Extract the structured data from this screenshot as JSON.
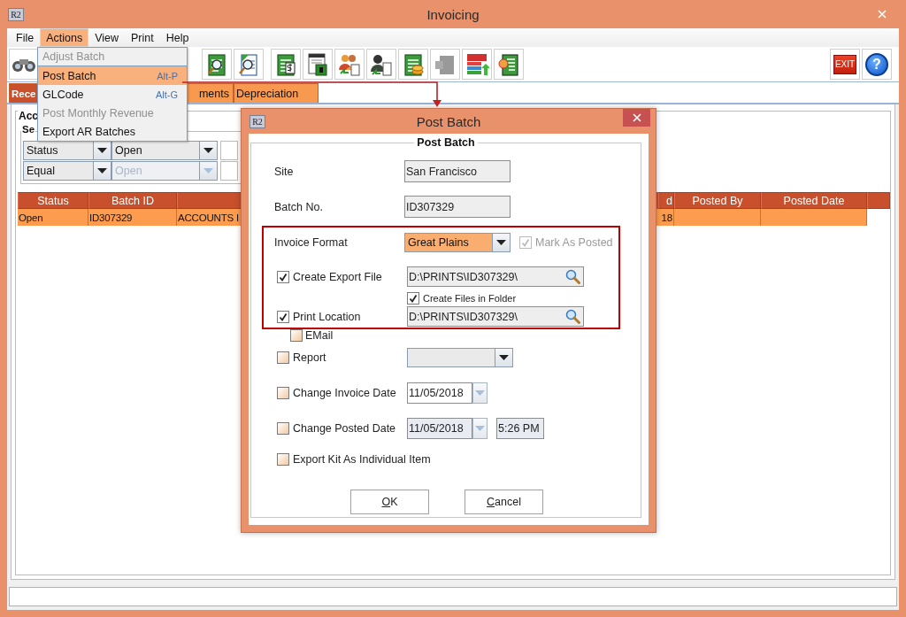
{
  "window": {
    "title": "Invoicing",
    "app_icon": "R2"
  },
  "menu_bar": [
    {
      "label": "File",
      "selected": false
    },
    {
      "label": "Actions",
      "selected": true
    },
    {
      "label": "View",
      "selected": false
    },
    {
      "label": "Print",
      "selected": false
    },
    {
      "label": "Help",
      "selected": false
    }
  ],
  "actions_menu": [
    {
      "label": "Adjust Batch",
      "disabled": true,
      "selected": false
    },
    {
      "label": "Post Batch",
      "shortcut": "Alt-P",
      "disabled": false,
      "selected": true
    },
    {
      "label": "GLCode",
      "shortcut": "Alt-G",
      "disabled": false,
      "selected": false
    },
    {
      "label": "Post Monthly Revenue",
      "disabled": true,
      "selected": false
    },
    {
      "label": "Export AR Batches",
      "disabled": false,
      "selected": false
    }
  ],
  "toolbar": {
    "exit": "EXIT",
    "help": "?"
  },
  "tabs": [
    {
      "label": "Rece",
      "selected": true
    },
    {
      "label": "ments",
      "selected": false
    },
    {
      "label": "Depreciation",
      "selected": false
    }
  ],
  "account_group": {
    "title": "Acc"
  },
  "search_group": {
    "title": "Se"
  },
  "filters": [
    [
      {
        "value": "Status",
        "disabled": false
      },
      {
        "value": "Open",
        "disabled": false
      }
    ],
    [
      {
        "value": "Equal",
        "disabled": false
      },
      {
        "value": "Open",
        "disabled": true
      }
    ]
  ],
  "table": {
    "columns": [
      "Status",
      "Batch ID",
      null,
      "d",
      "Posted By",
      "Posted Date"
    ],
    "rows": [
      [
        "Open",
        "ID307329",
        "ACCOUNTS I",
        "18",
        null,
        null
      ]
    ]
  },
  "dialog": {
    "title": "Post Batch",
    "app_icon": "R2",
    "group_title": "Post Batch",
    "site": {
      "label": "Site",
      "value": "San Francisco"
    },
    "batch_no": {
      "label": "Batch No.",
      "value": "ID307329"
    },
    "invoice_format": {
      "label": "Invoice Format",
      "value": "Great Plains"
    },
    "mark_as_posted": {
      "label": "Mark As Posted",
      "checked": true,
      "disabled": true
    },
    "create_export_file": {
      "label": "Create Export File",
      "checked": true,
      "path": "D:\\PRINTS\\ID307329\\"
    },
    "create_files_in_folder": {
      "label": "Create Files in Folder",
      "checked": true
    },
    "print_location": {
      "label": "Print Location",
      "checked": true,
      "path": "D:\\PRINTS\\ID307329\\"
    },
    "email": {
      "label": "EMail",
      "checked": false
    },
    "report": {
      "label": "Report",
      "checked": false
    },
    "change_invoice_date": {
      "label": "Change Invoice Date",
      "checked": false,
      "date": "11/05/2018",
      "disabled": false
    },
    "change_posted_date": {
      "label": "Change Posted Date",
      "checked": false,
      "date": "11/05/2018",
      "time": "5:26 PM",
      "disabled": true
    },
    "export_kit": {
      "label": "Export Kit As Individual Item",
      "checked": false
    },
    "buttons": [
      {
        "label": "OK"
      },
      {
        "label": "Cancel"
      }
    ]
  }
}
